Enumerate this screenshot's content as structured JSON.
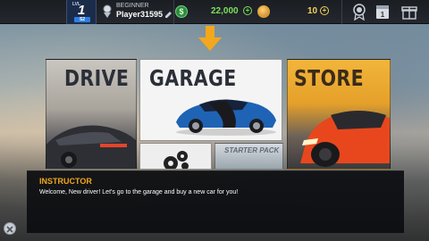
{
  "hud": {
    "level_label": "LVL",
    "level": "1",
    "xp_label": "S2",
    "rank": "BEGINNER",
    "player_name": "Player31595",
    "cash": "22,000",
    "gold": "10",
    "plus": "+"
  },
  "tiles": {
    "drive": "DRIVE",
    "garage": "GARAGE",
    "store": "STORE",
    "starter_pack": "STARTER PACK"
  },
  "dialog": {
    "title": "INSTRUCTOR",
    "message": "Welcome, New driver! Let's go to the garage and buy a new car for you!"
  },
  "colors": {
    "accent": "#f2a81c",
    "cash": "#7be05a",
    "gold": "#f3d257"
  },
  "icons": [
    "rank-badge-icon",
    "edit-pencil-icon",
    "cash-icon",
    "gold-coin-icon",
    "achievement-icon",
    "calendar-icon",
    "gift-icon",
    "gears-icon",
    "close-icon",
    "down-arrow-icon"
  ]
}
